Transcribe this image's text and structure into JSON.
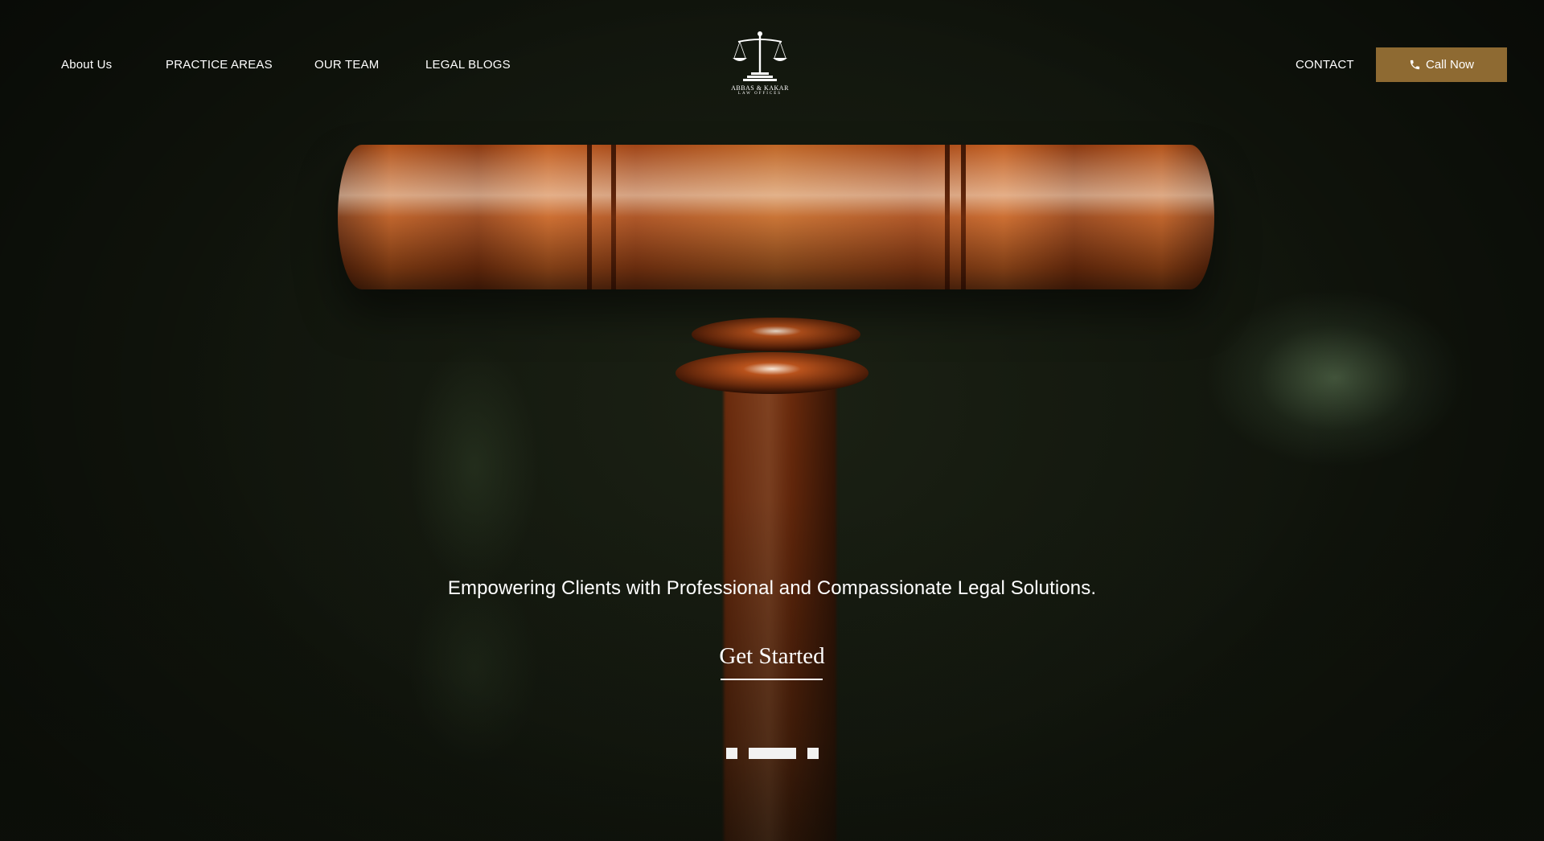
{
  "header": {
    "nav_left": [
      "About Us",
      "PRACTICE AREAS",
      "OUR TEAM",
      "LEGAL BLOGS"
    ],
    "nav_right": {
      "contact": "CONTACT",
      "call_now": "Call Now"
    },
    "logo": {
      "name": "ABBAS & KAKAR",
      "sub": "LAW OFFICES",
      "icon": "scales-of-justice-icon"
    }
  },
  "hero": {
    "tagline": "Empowering Clients with Professional and Compassionate Legal Solutions.",
    "cta": "Get Started",
    "slider": {
      "slide_count": 3,
      "active_index": 1
    }
  },
  "colors": {
    "accent": "#8e6a32",
    "background": "#141a10",
    "text": "#ffffff"
  }
}
